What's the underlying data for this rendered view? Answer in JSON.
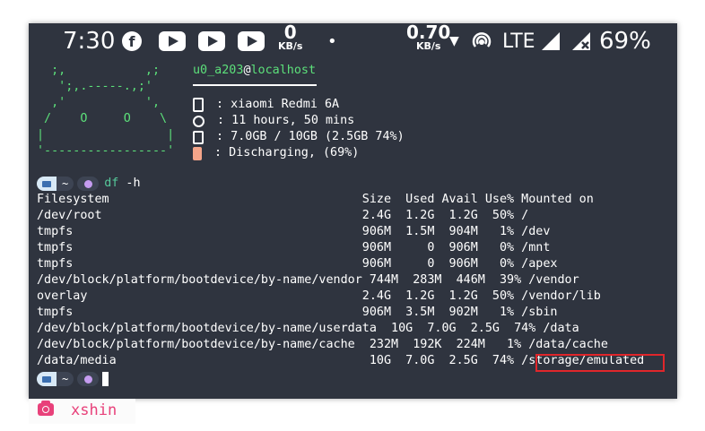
{
  "statusbar": {
    "time": "7:30",
    "icons": [
      "facebook-icon",
      "youtube-icon",
      "youtube-icon",
      "youtube-icon"
    ],
    "speed_left_value": "0",
    "speed_left_unit": "KB/s",
    "dot": "•",
    "speed_right_value": "0.70",
    "speed_right_unit": "KB/s",
    "network": "LTE",
    "battery": "69%"
  },
  "neofetch": {
    "ascii": "  ;,           ,;\n   ';,.-----.,;'\n  ,'           ',\n /    O     O    \\\n|                 |\n'-----------------'",
    "user": "u0_a203",
    "at": "@",
    "host": "localhost",
    "device": " : xiaomi Redmi 6A",
    "uptime": " : 11 hours, 50 mins",
    "memory": " : 7.0GB / 10GB (2.5GB 74%)",
    "battery": " : Discharging, (69%)"
  },
  "prompt": {
    "dir": "~",
    "command": "df",
    "arg": "-h"
  },
  "df": {
    "header": "Filesystem                                   Size  Used Avail Use% Mounted on",
    "rows": [
      "/dev/root                                    2.4G  1.2G  1.2G  50% /",
      "tmpfs                                        906M  1.5M  904M   1% /dev",
      "tmpfs                                        906M     0  906M   0% /mnt",
      "tmpfs                                        906M     0  906M   0% /apex",
      "/dev/block/platform/bootdevice/by-name/vendor 744M  283M  446M  39% /vendor",
      "overlay                                      2.4G  1.2G  1.2G  50% /vendor/lib",
      "tmpfs                                        906M  3.5M  902M   1% /sbin",
      "/dev/block/platform/bootdevice/by-name/userdata  10G  7.0G  2.5G  74% /data",
      "/dev/block/platform/bootdevice/by-name/cache  232M  192K  224M   1% /data/cache",
      "/data/media                                   10G  7.0G  2.5G  74% /storage/emulated"
    ]
  },
  "watermark": {
    "text": "xshin",
    "icon": "camera-icon"
  },
  "colors": {
    "terminal_bg": "#2f343f",
    "green": "#5ce07a",
    "highlight": "#e0262b",
    "watermark": "#e8417a"
  }
}
